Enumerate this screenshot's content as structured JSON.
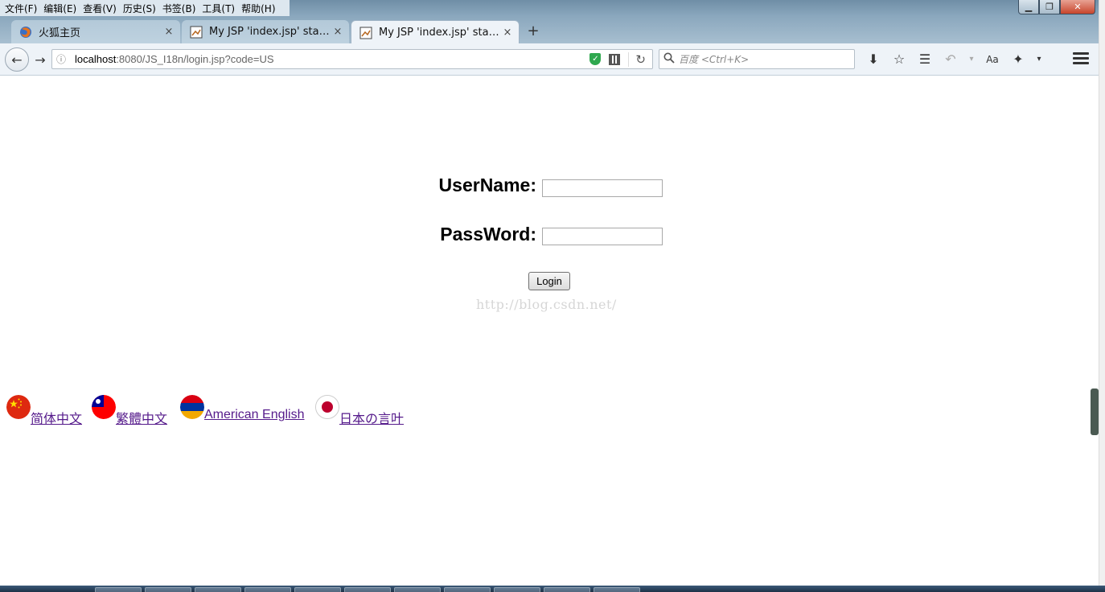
{
  "menubar": {
    "items": [
      "文件(F)",
      "编辑(E)",
      "查看(V)",
      "历史(S)",
      "书签(B)",
      "工具(T)",
      "帮助(H)"
    ]
  },
  "window_controls": {
    "minimize": "▁",
    "maximize": "❐",
    "close": "✕"
  },
  "tabs": [
    {
      "label": "火狐主页",
      "close": "×"
    },
    {
      "label": "My JSP 'index.jsp' startin...",
      "close": "×"
    },
    {
      "label": "My JSP 'index.jsp' startin...",
      "close": "×"
    }
  ],
  "new_tab": "+",
  "navbar": {
    "back": "←",
    "forward": "→",
    "url_host": "localhost",
    "url_rest": ":8080/JS_I18n/login.jsp?code=US",
    "reload": "↻",
    "search_placeholder": "百度 <Ctrl+K>"
  },
  "toolbar": {
    "download": "⬇",
    "bookmark_star": "☆",
    "reader": "☰",
    "undo": "↶",
    "dropdown": "▾",
    "font": "Aa",
    "addon": "✦"
  },
  "form": {
    "username_label": "UserName:",
    "password_label": "PassWord:",
    "username_value": "",
    "password_value": "",
    "login_label": "Login"
  },
  "watermark": "http://blog.csdn.net/",
  "languages": [
    {
      "label": "简体中文"
    },
    {
      "label": " 繁體中文"
    },
    {
      "label": " American English"
    },
    {
      "label": " 日本の言叶"
    }
  ],
  "colors": {
    "link_visited": "#551a8b",
    "chrome_bg": "#eef3f8",
    "shield_green": "#2fa84f"
  }
}
